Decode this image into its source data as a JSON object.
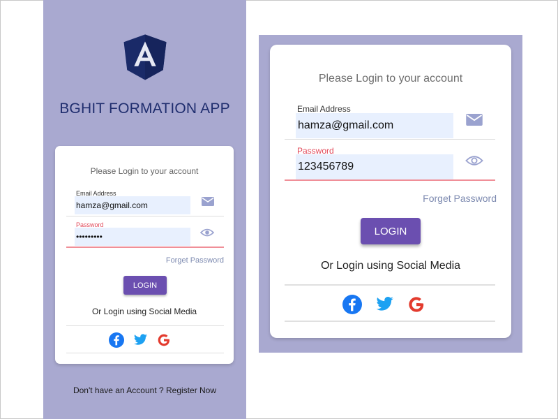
{
  "app": {
    "title": "BGHIT FORMATION APP",
    "logo_letter": "A",
    "logo_icon": "angular-logo"
  },
  "login": {
    "subtitle": "Please Login to your account",
    "email_label": "Email Address",
    "email_value": "hamza@gmail.com",
    "password_label": "Password",
    "password_value_masked": "•••••••••",
    "password_value_revealed": "123456789",
    "forget_label": "Forget Password",
    "login_label": "LOGIN",
    "social_label": "Or Login using Social Media",
    "social_icons": [
      "facebook-icon",
      "twitter-icon",
      "google-icon"
    ]
  },
  "footer": {
    "register_label": "Don't have an Account ? Register Now"
  },
  "colors": {
    "panel_bg": "#a9a9d0",
    "title": "#1f2d6e",
    "logo": "#1a2a68",
    "button": "#6b4fb0",
    "input_bg": "#e8f0fe",
    "error": "#e24a5a",
    "icon": "#9aa2cf",
    "facebook": "#1877f2",
    "twitter": "#1da1f2"
  }
}
